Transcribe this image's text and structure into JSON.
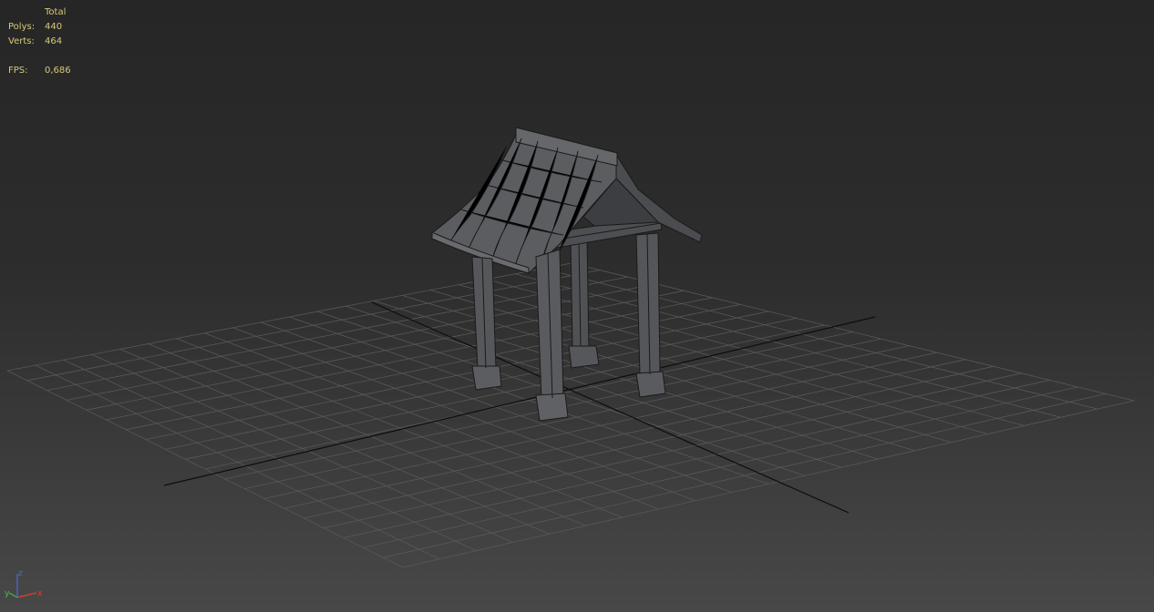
{
  "viewport": {
    "background_top": "#262626",
    "background_bottom": "#484848"
  },
  "stats": {
    "header": "Total",
    "polys_label": "Polys:",
    "polys_value": "440",
    "verts_label": "Verts:",
    "verts_value": "464",
    "fps_label": "FPS:",
    "fps_value": "0,686",
    "text_color": "#d8c97a"
  },
  "axis_gizmo": {
    "x_label": "x",
    "y_label": "y",
    "z_label": "z",
    "x_color": "#e04030",
    "y_color": "#40c040",
    "z_color": "#4a6ae0"
  },
  "model": {
    "name_icon": "pavilion-gate-mesh",
    "shade_color": "#5a5b5e",
    "wire_color": "#1a1a1a"
  }
}
